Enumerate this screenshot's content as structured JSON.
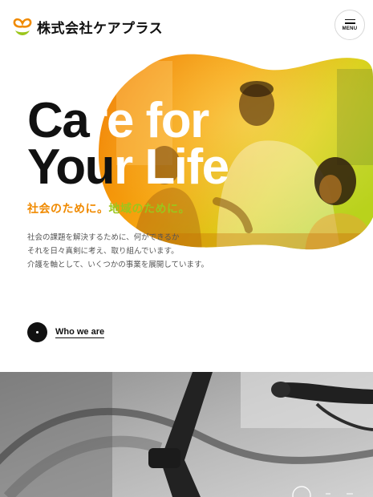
{
  "header": {
    "company_name": "株式会社ケアプラス",
    "menu_label": "MENU"
  },
  "hero": {
    "headline_line1_a": "Ca",
    "headline_line1_b": "re for",
    "headline_line2_a": "You",
    "headline_line2_b": "r Life",
    "tagline_part1": "社会のために。",
    "tagline_part2": "地域のために。",
    "description": [
      "社会の課題を解決するために、何ができるか",
      "それを日々真剣に考え、取り組んでいます。",
      "介護を軸として、いくつかの事業を展開しています。"
    ],
    "cta_label": "Who we are"
  },
  "colors": {
    "orange": "#f08a00",
    "green": "#9bc61c",
    "dark": "#111111"
  },
  "icons": {
    "logo": "heart-leaf-logo-icon",
    "menu": "hamburger-icon",
    "cta": "dot-icon"
  }
}
